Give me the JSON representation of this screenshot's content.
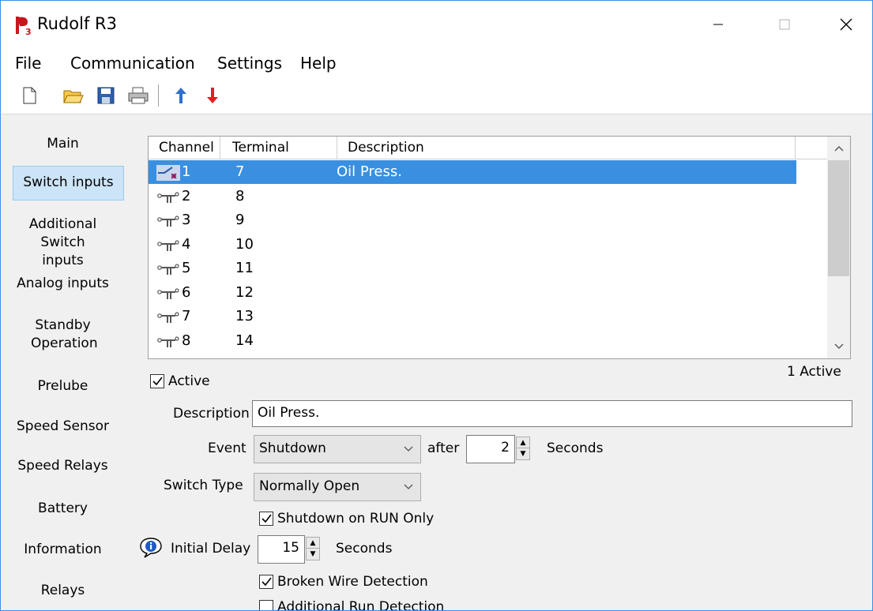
{
  "window": {
    "title": "Rudolf R3",
    "icon_name": "rudolf-app-icon"
  },
  "menu": [
    "File",
    "Communication",
    "Settings",
    "Help"
  ],
  "toolbar": {
    "buttons": [
      "new-file-icon",
      "open-folder-icon",
      "save-icon",
      "print-icon",
      "upload-arrow-icon",
      "download-arrow-icon"
    ]
  },
  "nav": [
    "Main",
    "Switch inputs",
    "Additional Switch inputs",
    "Analog inputs",
    "Standby Operation",
    "Prelube",
    "Speed Sensor",
    "Speed Relays",
    "Battery",
    "Information",
    "Relays"
  ],
  "nav_selected": "Switch inputs",
  "table": {
    "columns": [
      "Channel",
      "Terminal",
      "Description"
    ],
    "rows": [
      {
        "channel": "1",
        "terminal": "7",
        "description": "Oil Press.",
        "selected": true
      },
      {
        "channel": "2",
        "terminal": "8",
        "description": ""
      },
      {
        "channel": "3",
        "terminal": "9",
        "description": ""
      },
      {
        "channel": "4",
        "terminal": "10",
        "description": ""
      },
      {
        "channel": "5",
        "terminal": "11",
        "description": ""
      },
      {
        "channel": "6",
        "terminal": "12",
        "description": ""
      },
      {
        "channel": "7",
        "terminal": "13",
        "description": ""
      },
      {
        "channel": "8",
        "terminal": "14",
        "description": ""
      }
    ]
  },
  "active_count": "1 Active",
  "form": {
    "active_label": "Active",
    "active_checked": true,
    "description_label": "Description",
    "description_value": "Oil Press.",
    "event_label": "Event",
    "event_value": "Shutdown",
    "after_label": "after",
    "after_value": "2",
    "seconds_label": "Seconds",
    "switch_type_label": "Switch Type",
    "switch_type_value": "Normally Open",
    "shutdown_on_run_label": "Shutdown on RUN Only",
    "shutdown_on_run_checked": true,
    "initial_delay_label": "Initial Delay",
    "initial_delay_value": "15",
    "initial_delay_unit": "Seconds",
    "broken_wire_label": "Broken Wire Detection",
    "broken_wire_checked": true,
    "additional_run_label": "Additional Run Detection",
    "additional_run_checked": false
  },
  "colors": {
    "selection": "#3990e0",
    "nav_selected_bg": "#cce4f7"
  }
}
